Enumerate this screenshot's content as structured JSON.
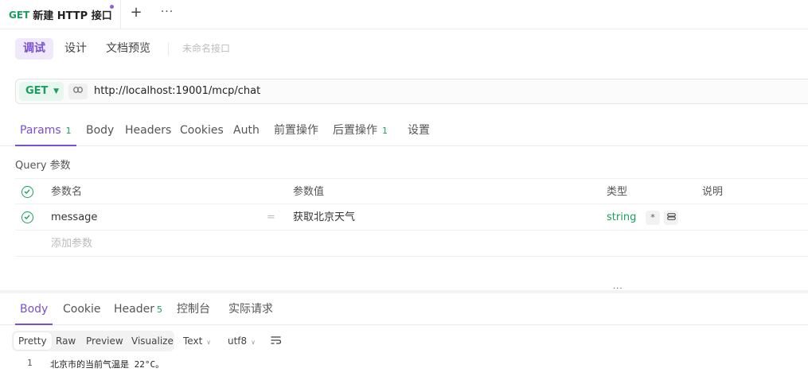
{
  "tab": {
    "method": "GET",
    "title": "新建 HTTP 接口",
    "plus": "+",
    "more": "···"
  },
  "modes": {
    "items": [
      "调试",
      "设计",
      "文档预览"
    ],
    "endpoint_name": "未命名接口"
  },
  "request": {
    "method": "GET",
    "url": "http://localhost:19001/mcp/chat",
    "link_icon": "link-icon"
  },
  "req_tabs": {
    "params": "Params",
    "params_count": "1",
    "body": "Body",
    "headers": "Headers",
    "cookies": "Cookies",
    "auth": "Auth",
    "pre": "前置操作",
    "post": "后置操作",
    "post_count": "1",
    "settings": "设置"
  },
  "query": {
    "title": "Query 参数",
    "headers": {
      "name": "参数名",
      "value": "参数值",
      "type": "类型",
      "desc": "说明"
    },
    "rows": [
      {
        "name": "message",
        "eq": "=",
        "value": "获取北京天气",
        "type": "string",
        "required": "*",
        "enabled": true
      }
    ],
    "add_placeholder": "添加参数"
  },
  "resizer": {
    "dots": "···"
  },
  "res_tabs": {
    "body": "Body",
    "cookie": "Cookie",
    "header": "Header",
    "header_count": "5",
    "console": "控制台",
    "actual": "实际请求"
  },
  "format": {
    "views": [
      "Pretty",
      "Raw",
      "Preview",
      "Visualize"
    ],
    "text": "Text",
    "encoding": "utf8"
  },
  "response": {
    "line_no": "1",
    "line_text": "北京市的当前气温是 22°C。"
  },
  "colors": {
    "accent": "#7a4fd0",
    "get": "#1a9e5f"
  }
}
